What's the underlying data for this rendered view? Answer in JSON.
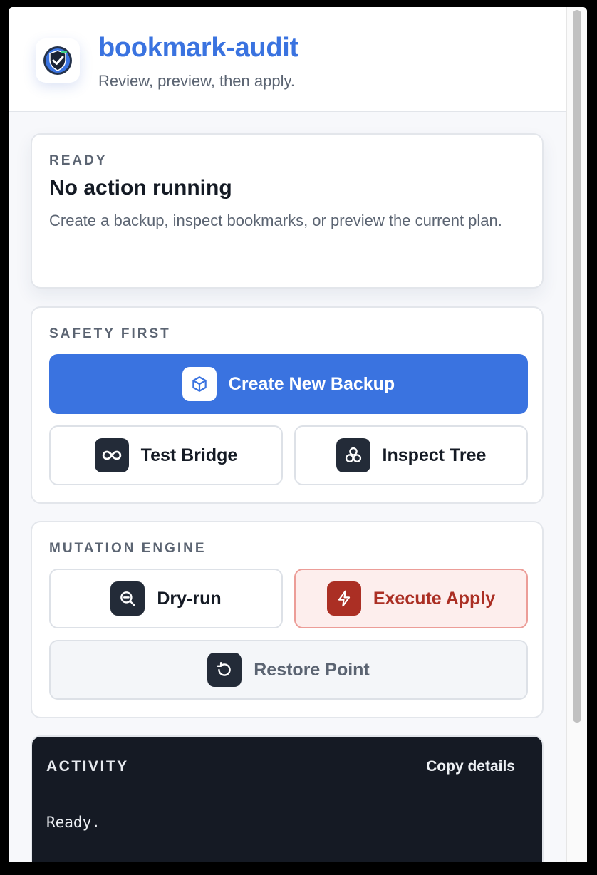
{
  "header": {
    "title": "bookmark-audit",
    "subtitle": "Review, preview, then apply.",
    "logo_icon": "shield-check-icon"
  },
  "status": {
    "label": "READY",
    "heading": "No action running",
    "description": "Create a backup, inspect bookmarks, or preview the current plan."
  },
  "safety": {
    "label": "SAFETY FIRST",
    "create_backup": {
      "label": "Create New Backup",
      "icon": "cube-icon"
    },
    "test_bridge": {
      "label": "Test Bridge",
      "icon": "infinity-icon"
    },
    "inspect_tree": {
      "label": "Inspect Tree",
      "icon": "cluster-icon"
    }
  },
  "mutation": {
    "label": "MUTATION ENGINE",
    "dry_run": {
      "label": "Dry-run",
      "icon": "zoom-out-icon"
    },
    "execute_apply": {
      "label": "Execute Apply",
      "icon": "lightning-icon"
    },
    "restore_point": {
      "label": "Restore Point",
      "icon": "restore-icon"
    }
  },
  "activity": {
    "title": "ACTIVITY",
    "copy_label": "Copy details",
    "log": "Ready."
  },
  "colors": {
    "accent": "#3a73e0",
    "danger": "#ab2f24",
    "danger_bg": "#fdeeed",
    "dark": "#151a24"
  }
}
